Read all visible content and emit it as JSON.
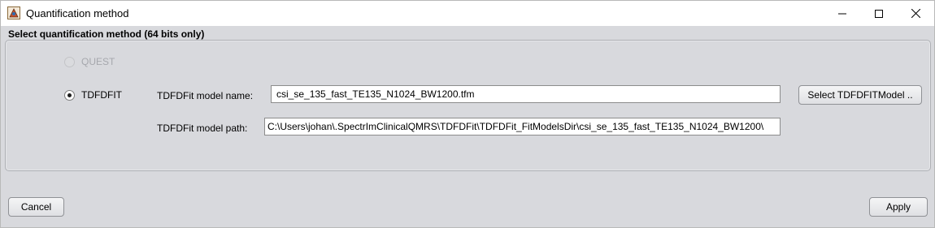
{
  "window": {
    "title": "Quantification method",
    "icon": "app-icon",
    "controls": [
      "minimize-icon",
      "maximize-icon",
      "close-icon"
    ]
  },
  "section": {
    "header": "Select quantification method (64 bits only)"
  },
  "options": {
    "quest": {
      "label": "QUEST",
      "selected": false,
      "enabled": false
    },
    "tdfdfit": {
      "label": "TDFDFIT",
      "selected": true,
      "enabled": true
    }
  },
  "tdfdfit": {
    "model_name_label": "TDFDFit model name:",
    "model_name_value": "csi_se_135_fast_TE135_N1024_BW1200.tfm",
    "model_path_label": "TDFDFit model path:",
    "model_path_value": "C:\\Users\\johan\\.SpectrImClinicalQMRS\\TDFDFit\\TDFDFit_FitModelsDir\\csi_se_135_fast_TE135_N1024_BW1200\\",
    "select_button": "Select TDFDFITModel .."
  },
  "footer": {
    "cancel": "Cancel",
    "apply": "Apply"
  }
}
